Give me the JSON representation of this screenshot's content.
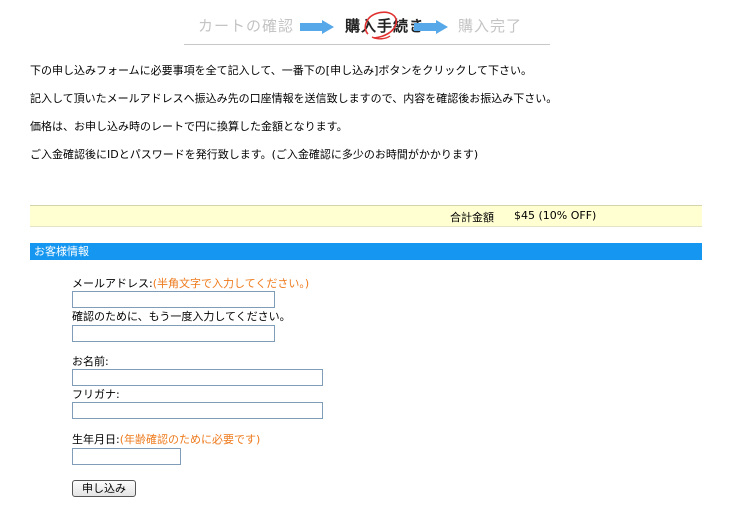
{
  "steps": {
    "step1": "カートの確認",
    "step2": "購入手続き",
    "step3": "購入完了"
  },
  "intro": {
    "line1": "下の申し込みフォームに必要事項を全て記入して、一番下の[申し込み]ボタンをクリックして下さい。",
    "line2": "記入して頂いたメールアドレスへ振込み先の口座情報を送信致しますので、内容を確認後お振込み下さい。",
    "line3": "価格は、お申し込み時のレートで円に換算した金額となります。",
    "line4": "ご入金確認後にIDとパスワードを発行致します。(ご入金確認に多少のお時間がかかります)"
  },
  "total": {
    "label": "合計金額",
    "value": "$45 (10% OFF)"
  },
  "section": {
    "title": "お客様情報"
  },
  "form": {
    "email_label": "メールアドレス:",
    "email_note": "(半角文字で入力してください。)",
    "email_value": "",
    "email_confirm_label": "確認のために、もう一度入力してください。",
    "email_confirm_value": "",
    "name_label": "お名前:",
    "name_value": "",
    "furigana_label": "フリガナ:",
    "furigana_value": "",
    "birthdate_label": "生年月日:",
    "birthdate_note": "(年齢確認のために必要です)",
    "birthdate_value": "",
    "submit_label": "申し込み"
  },
  "colors": {
    "section_header_bg": "#1596f0",
    "total_bar_bg": "#ffffd2",
    "note_text": "#ee7a1c",
    "step_arrow": "#56a8e8",
    "step_circle": "#e03030"
  }
}
